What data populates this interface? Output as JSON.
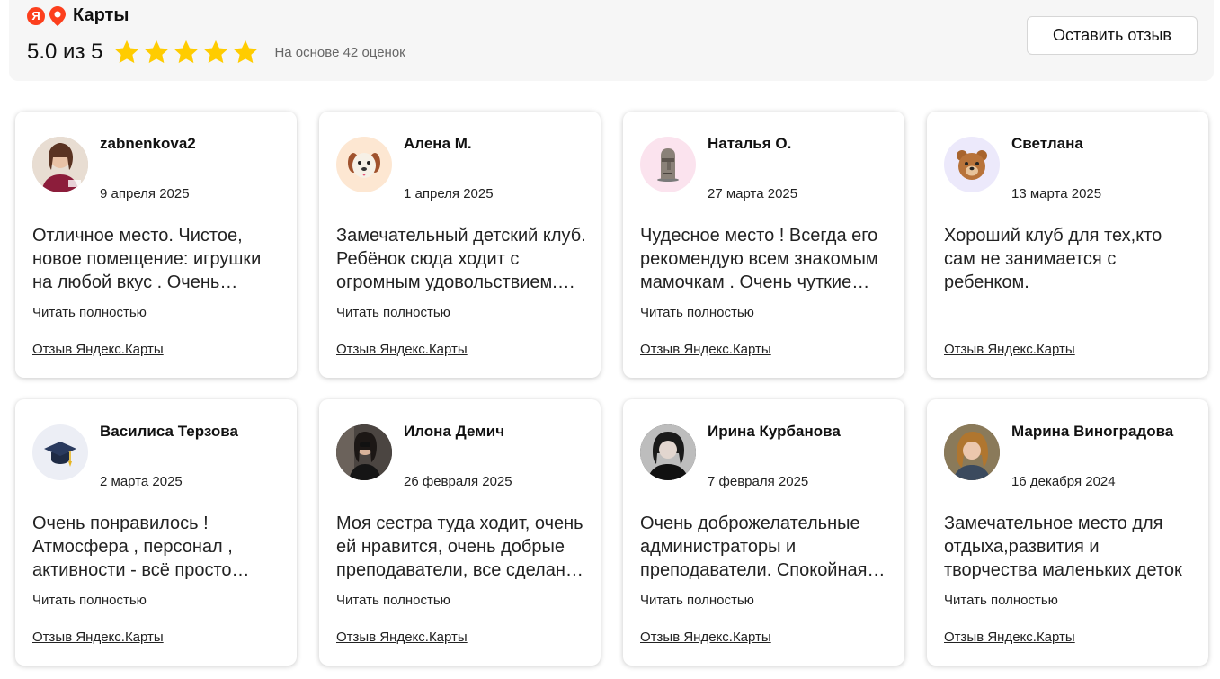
{
  "header": {
    "logo_letter": "Я",
    "brand_title": "Карты",
    "rating_text": "5.0 из 5",
    "rating_value": 5,
    "rating_max": 5,
    "based_on": "На основе 42 оценок",
    "leave_review_label": "Оставить отзыв",
    "star_color": "#ffcc00"
  },
  "reviews": [
    {
      "name": "zabnenkova2",
      "date": "9 апреля 2025",
      "text": "Отличное место. Чистое, новое помещение: игрушки на любой вкус . Очень интересные занятия",
      "read_more": "Читать полностью",
      "source": "Отзыв Яндекс.Карты",
      "avatar_icon": "photo-avatar"
    },
    {
      "name": "Алена М.",
      "date": "1 апреля 2025",
      "text": "Замечательный детский клуб. Ребёнок сюда ходит с огромным удовольствием. Спасибо",
      "read_more": "Читать полностью",
      "source": "Отзыв Яндекс.Карты",
      "avatar_icon": "dog-emoji-icon"
    },
    {
      "name": "Наталья О.",
      "date": "27 марта 2025",
      "text": "Чудесное место ! Всегда его рекомендую всем знакомым мамочкам . Очень чуткие педагоги",
      "read_more": "Читать полностью",
      "source": "Отзыв Яндекс.Карты",
      "avatar_icon": "moai-emoji-icon"
    },
    {
      "name": "Светлана",
      "date": "13 марта 2025",
      "text": "Хороший клуб для тех,кто сам не занимается с ребенком.",
      "read_more": "",
      "source": "Отзыв Яндекс.Карты",
      "avatar_icon": "bear-emoji-icon"
    },
    {
      "name": "Василиса Терзова",
      "date": "2 марта 2025",
      "text": "Очень понравилось ! Атмосфера , персонал , активности - всё просто супер",
      "read_more": "Читать полностью",
      "source": "Отзыв Яндекс.Карты",
      "avatar_icon": "graduation-cap-emoji-icon"
    },
    {
      "name": "Илона Демич",
      "date": "26 февраля 2025",
      "text": "Моя сестра туда ходит, очень ей нравится, очень добрые преподаватели, все сделано с любовью",
      "read_more": "Читать полностью",
      "source": "Отзыв Яндекс.Карты",
      "avatar_icon": "photo-avatar"
    },
    {
      "name": "Ирина Курбанова",
      "date": "7 февраля 2025",
      "text": "Очень доброжелательные администраторы и преподаватели. Спокойная атмосфера",
      "read_more": "Читать полностью",
      "source": "Отзыв Яндекс.Карты",
      "avatar_icon": "photo-avatar"
    },
    {
      "name": "Марина Виноградова",
      "date": "16 декабря 2024",
      "text": "Замечательное место для отдыха,развития и творчества маленьких деток",
      "read_more": "Читать полностью",
      "source": "Отзыв Яндекс.Карты",
      "avatar_icon": "photo-avatar"
    }
  ]
}
